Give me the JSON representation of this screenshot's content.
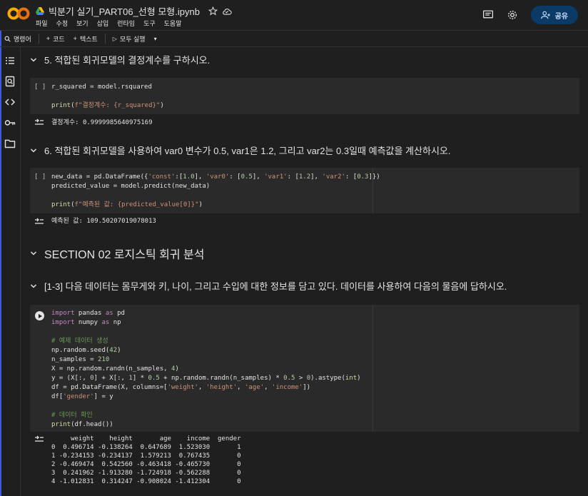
{
  "header": {
    "file_name": "빅분기 실기_PART06_선형 모형.ipynb",
    "menu": [
      "파일",
      "수정",
      "보기",
      "삽입",
      "런타임",
      "도구",
      "도움말"
    ],
    "share_label": "공유"
  },
  "toolbar": {
    "command_label": "명령어",
    "code_label": "코드",
    "text_label": "텍스트",
    "run_all_label": "모두 실행"
  },
  "sections": {
    "h5": "5. 적합된 회귀모델의 결정계수를 구하시오.",
    "h6": "6. 적합된 회귀모델을 사용하여 var0 변수가 0.5, var1은 1.2, 그리고 var2는 0.3일때 예측값을 계산하시오.",
    "section02": "SECTION 02 로지스틱 회귀 분석",
    "q13": "[1-3] 다음 데이터는 몸무게와 키, 나이, 그리고 수입에 대한 정보를 담고 있다. 데이터를 사용하여 다음의 물음에 답하시오."
  },
  "cells": {
    "cell1": {
      "bracket": "[ ]",
      "output": "결정계수: 0.9999985640975169"
    },
    "cell2": {
      "bracket": "[ ]",
      "output": "예측된 값: 109.50207019078013"
    },
    "cell3": {
      "output_header": "     weight    height       age    income  gender",
      "output_rows": [
        "0  0.496714 -0.138264  0.647689  1.523030       1",
        "1 -0.234153 -0.234137  1.579213  0.767435       0",
        "2 -0.469474  0.542560 -0.463418 -0.465730       0",
        "3  0.241962 -1.913280 -1.724918 -0.562288       0",
        "4 -1.012831  0.314247 -0.908024 -1.412304       0"
      ]
    }
  },
  "colors": {
    "background": "#1f1f1f",
    "cell_bg": "#2a2a2a",
    "keyword": "#c586c0",
    "string": "#ce9178",
    "number": "#b5cea8",
    "comment": "#6a9955",
    "share_bg": "#0b3a66"
  },
  "icons": [
    "colab-logo",
    "drive-icon",
    "star-icon",
    "cloud-icon",
    "comment-icon",
    "gear-icon",
    "person-add-icon",
    "search-icon",
    "plus-icon",
    "play-icon",
    "chevron-down-icon",
    "list-icon",
    "find-icon",
    "code-icon",
    "key-icon",
    "folder-icon",
    "output-icon"
  ]
}
